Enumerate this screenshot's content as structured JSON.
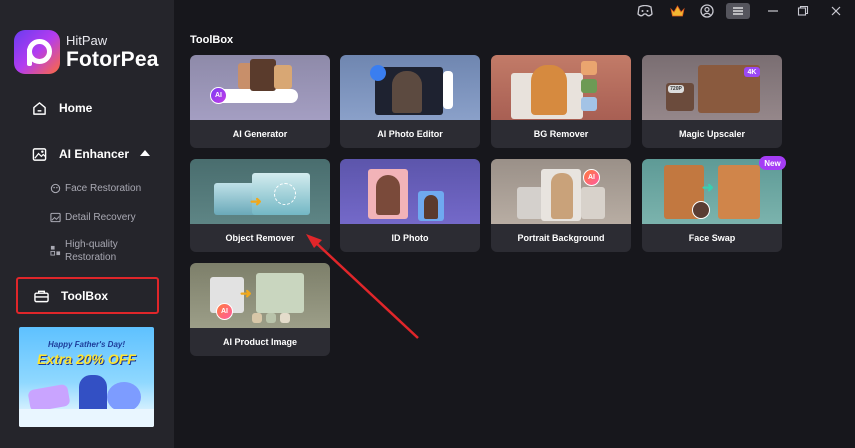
{
  "app": {
    "brand_small": "HitPaw",
    "brand_big": "FotorPea"
  },
  "sidebar": {
    "home": "Home",
    "ai_enhancer": "AI Enhancer",
    "sub_items": [
      "Face Restoration",
      "Detail Recovery",
      "High-quality",
      "Restoration"
    ],
    "toolbox": "ToolBox",
    "banner": {
      "line1": "Happy Father's Day!",
      "line2": "Extra 20% OFF"
    }
  },
  "main": {
    "section_title": "ToolBox",
    "tools": [
      {
        "label": "AI Generator",
        "ai_badge": "AI"
      },
      {
        "label": "AI Photo Editor"
      },
      {
        "label": "BG Remover"
      },
      {
        "label": "Magic Upscaler",
        "badge_4k": "4K",
        "badge_720": "720P"
      },
      {
        "label": "Object Remover"
      },
      {
        "label": "ID Photo"
      },
      {
        "label": "Portrait Background",
        "ai_badge": "AI"
      },
      {
        "label": "Face Swap",
        "badge": "New"
      },
      {
        "label": "AI Product Image",
        "ai_badge": "AI"
      }
    ]
  },
  "colors": {
    "highlight": "#e0262a",
    "accent": "#a53df5"
  },
  "icons": [
    "discord-icon",
    "crown-icon",
    "user-icon",
    "menu-icon",
    "minimize-icon",
    "maximize-icon",
    "close-icon",
    "home-icon",
    "enhancer-icon",
    "toolbox-icon",
    "arrow-annotation"
  ]
}
